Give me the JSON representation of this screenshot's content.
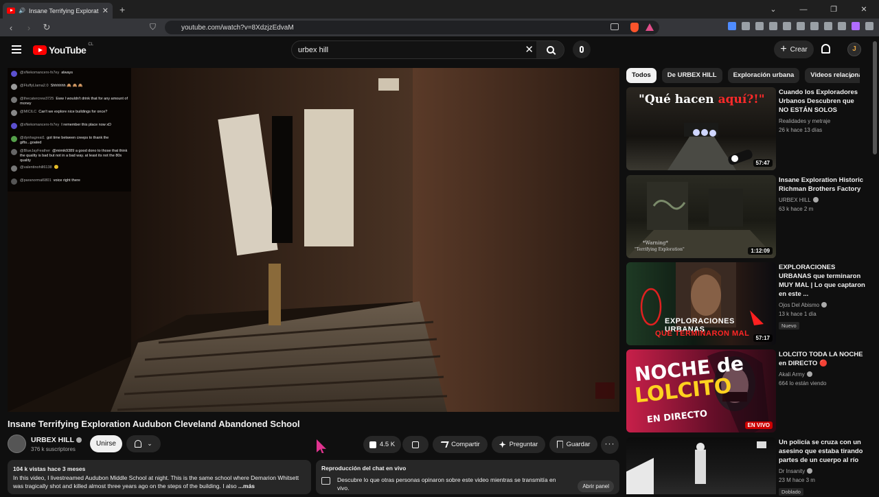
{
  "browser": {
    "tab_title": "Insane Terrifying Exploration",
    "url": "youtube.com/watch?v=8XdzjzEdvaM"
  },
  "header": {
    "logo": "YouTube",
    "country": "CL",
    "search_value": "urbex hill",
    "create_label": "Crear",
    "avatar_letter": "J"
  },
  "chat_overlay": [
    {
      "user": "@xNekomancerx-fx7ey",
      "text": "always",
      "color": "#5b4fcf"
    },
    {
      "user": "@FluffyLlama2.0",
      "text": "Shhhhhh 🙈 🙈 🙈",
      "color": "#999999"
    },
    {
      "user": "@thecatercrew3725",
      "text": "Eww I wouldn't drink that for any amount of money",
      "color": "#777777"
    },
    {
      "user": "@MICILC",
      "text": "Can't we explore nice buildings for once?",
      "color": "#888888"
    },
    {
      "user": "@xNekomancerx-fx7ey",
      "text": "I remember this place now xD",
      "color": "#5b4fcf"
    },
    {
      "user": "@dynhagreat1",
      "text": "got time between creeps to thank the gifts...goated",
      "color": "#55a04a"
    },
    {
      "user": "@BlueJayFeather",
      "text": "@mimik9389 a good dono to those that think the quality is bad but not in a bad way. at least its not the 80s quality",
      "color": "#666666"
    },
    {
      "user": "@valentinohill6138",
      "text": "🙂",
      "color": "#777777"
    },
    {
      "user": "@paranormal6801",
      "text": "voice right there",
      "color": "#555555"
    }
  ],
  "video": {
    "title": "Insane Terrifying Exploration Audubon Cleveland Abandoned School",
    "channel": "URBEX HILL",
    "subscribers": "376 k suscriptores",
    "join_label": "Unirse",
    "likes": "4.5 K",
    "share_label": "Compartir",
    "ask_label": "Preguntar",
    "save_label": "Guardar",
    "more_label": "···",
    "stats": "104 k vistas  hace 3 meses",
    "description": "In this video, I livestreamed Audubon Middle School at night. This is the same school where Demarion Whitsett was tragically shot and killed almost three years ago on the steps of the building. I also",
    "more_link": "...más"
  },
  "live_chat_replay": {
    "title": "Reproducción del chat en vivo",
    "text": "Descubre lo que otras personas opinaron sobre este video mientras se transmitía en vivo.",
    "button": "Abrir panel"
  },
  "chips": [
    "Todos",
    "De URBEX HILL",
    "Exploración urbana",
    "Videos relacionados"
  ],
  "recommendations": [
    {
      "title": "Cuando los Exploradores Urbanos Descubren que NO ESTÁN SOLOS",
      "channel": "Realidades y metraje",
      "meta": "26 k  hace 13 días",
      "duration": "57:47",
      "thumb_text": "\"Qué hacen ",
      "thumb_text_red": "aquí?!\""
    },
    {
      "title": "Insane Exploration Historic Richman Brothers Factory",
      "channel": "URBEX HILL",
      "meta": "63 k  hace 2 m",
      "duration": "1:12:09",
      "thumb_text": "*Warning*",
      "thumb_text2": "\"Terrifying Exploration\""
    },
    {
      "title": "EXPLORACIONES URBANAS que terminaron MUY MAL | Lo que captaron en este ...",
      "channel": "Ojos Del Abismo",
      "meta": "13 k  hace 1 día",
      "badge": "Nuevo",
      "duration": "57:17",
      "thumb_text": "EXPLORACIONES URBANAS",
      "thumb_text_red": "QUE TERMINARON MAL"
    },
    {
      "title": "LOLCITO TODA LA NOCHE en DIRECTO 🔴",
      "channel": "Akali Army",
      "meta": "664 lo están viendo",
      "duration": "EN VIVO",
      "thumb_text": "NOCHE de",
      "thumb_text_yellow": "LOLCITO",
      "thumb_text3": "EN DIRECTO"
    },
    {
      "title": "Un policía se cruza con un asesino que estaba tirando partes de un cuerpo al río",
      "channel": "Dr Insanity",
      "meta": "23 M  hace 3 m",
      "badge": "Doblado",
      "duration": ""
    }
  ]
}
